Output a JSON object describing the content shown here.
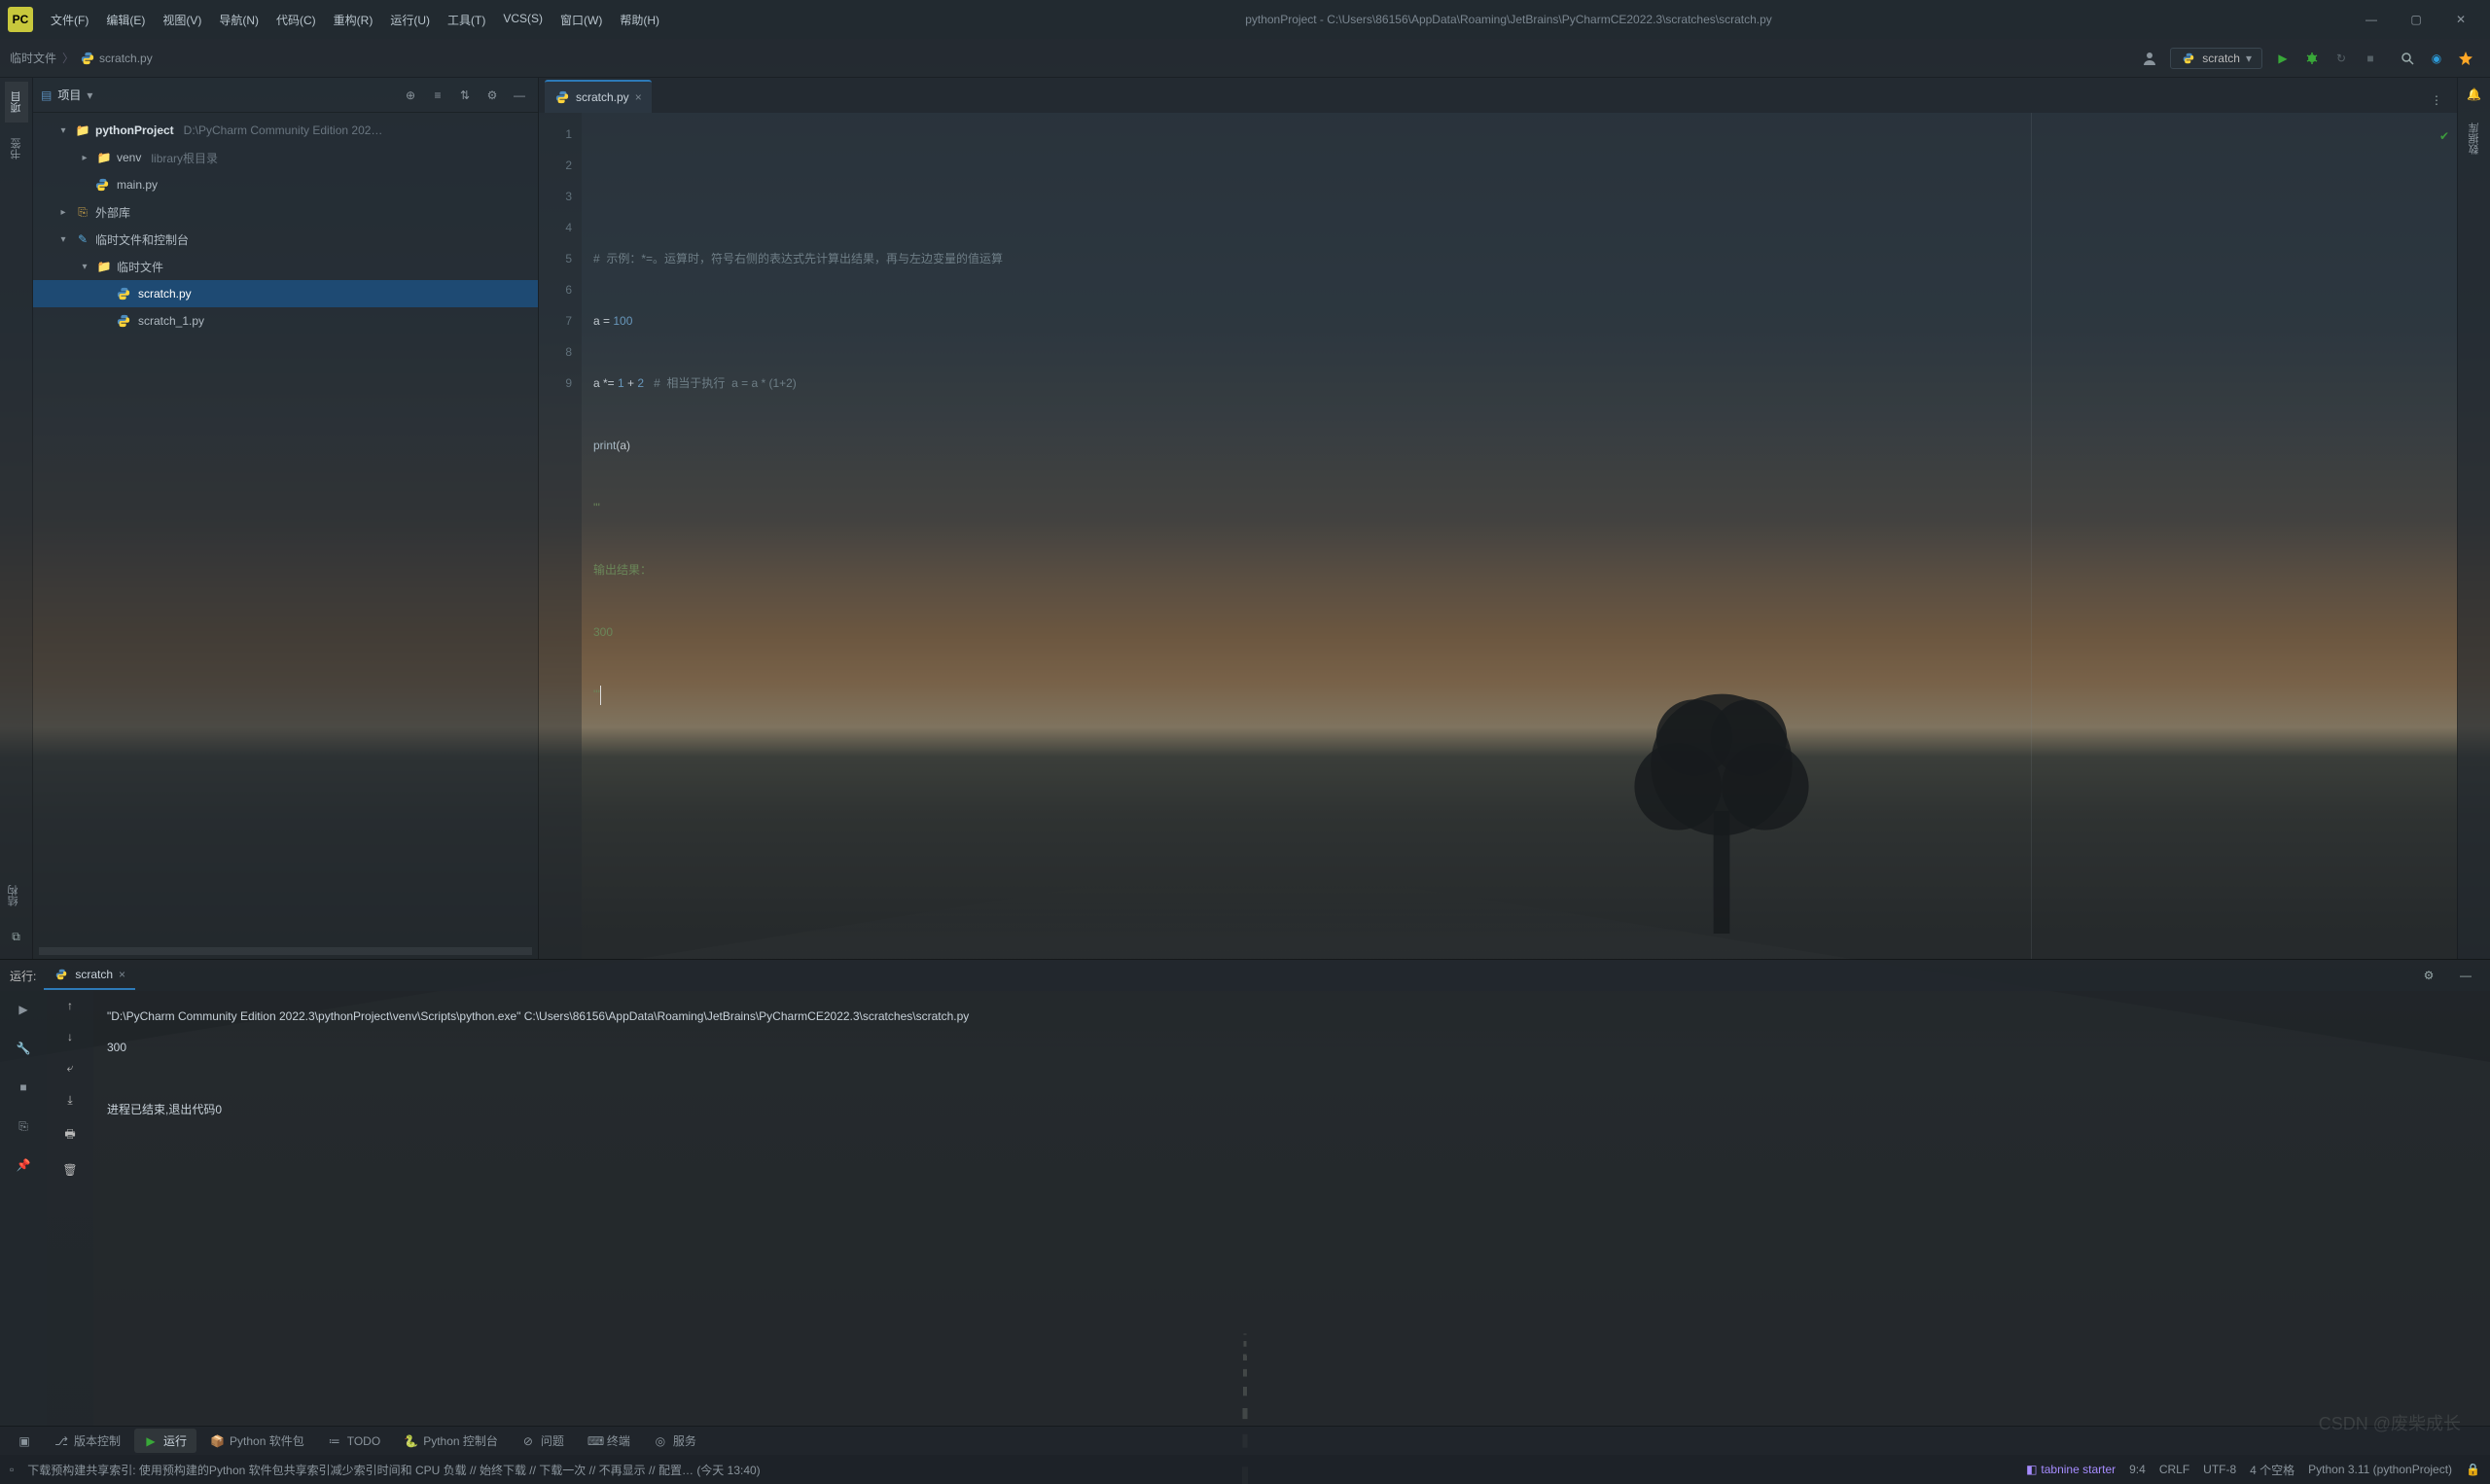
{
  "title_bar": {
    "app_icon_text": "PC",
    "menus": [
      "文件(F)",
      "编辑(E)",
      "视图(V)",
      "导航(N)",
      "代码(C)",
      "重构(R)",
      "运行(U)",
      "工具(T)",
      "VCS(S)",
      "窗口(W)",
      "帮助(H)"
    ],
    "title": "pythonProject - C:\\Users\\86156\\AppData\\Roaming\\JetBrains\\PyCharmCE2022.3\\scratches\\scratch.py"
  },
  "breadcrumb": {
    "root": "临时文件",
    "file": "scratch.py"
  },
  "run_config": {
    "label": "scratch"
  },
  "left_tabs": {
    "project": "项目",
    "bookmark": "书签",
    "structure": "结构"
  },
  "right_tabs": {
    "notify": "通知",
    "db": "数据库"
  },
  "project_panel": {
    "title": "项目",
    "tree": {
      "root": "pythonProject",
      "root_hint": "D:\\PyCharm Community Edition 202…",
      "venv": "venv",
      "venv_hint": "library根目录",
      "main": "main.py",
      "ext": "外部库",
      "scratches": "临时文件和控制台",
      "scratches_sub": "临时文件",
      "scratch": "scratch.py",
      "scratch1": "scratch_1.py"
    }
  },
  "editor": {
    "tab": "scratch.py",
    "lines": [
      "1",
      "2",
      "3",
      "4",
      "5",
      "6",
      "7",
      "8",
      "9"
    ],
    "code": {
      "l2": "#  示例：*=。运算时，符号右侧的表达式先计算出结果，再与左边变量的值运算",
      "l3_var": "a ",
      "l3_eq": "= ",
      "l3_num": "100",
      "l4_a": "a ",
      "l4_op": "*= ",
      "l4_n1": "1 ",
      "l4_plus": "+ ",
      "l4_n2": "2",
      "l4_c": "   #  相当于执行  a = a * (1+2)",
      "l5_fn": "print",
      "l5_p": "(a)",
      "l6": "'''",
      "l7": "输出结果：",
      "l8": "300",
      "l9": "'''"
    }
  },
  "run_panel": {
    "label": "运行:",
    "tab": "scratch",
    "console_line1": "\"D:\\PyCharm Community Edition 2022.3\\pythonProject\\venv\\Scripts\\python.exe\" C:\\Users\\86156\\AppData\\Roaming\\JetBrains\\PyCharmCE2022.3\\scratches\\scratch.py",
    "console_line2": "300",
    "console_line3": "",
    "console_line4": "进程已结束,退出代码0"
  },
  "bottom_tabs": {
    "vcs": "版本控制",
    "run": "运行",
    "pkg": "Python 软件包",
    "todo": "TODO",
    "pyconsole": "Python 控制台",
    "problems": "问题",
    "terminal": "终端",
    "services": "服务"
  },
  "status": {
    "msg": "下载预构建共享索引: 使用预构建的Python 软件包共享索引减少索引时间和 CPU 负载 // 始终下载 // 下载一次 // 不再显示 // 配置… (今天 13:40)",
    "tabnine": "tabnine starter",
    "pos": "9:4",
    "eol": "CRLF",
    "enc": "UTF-8",
    "indent": "4 个空格",
    "interp": "Python 3.11 (pythonProject)",
    "lock": "🔒"
  },
  "watermark": "CSDN @废柴成长"
}
